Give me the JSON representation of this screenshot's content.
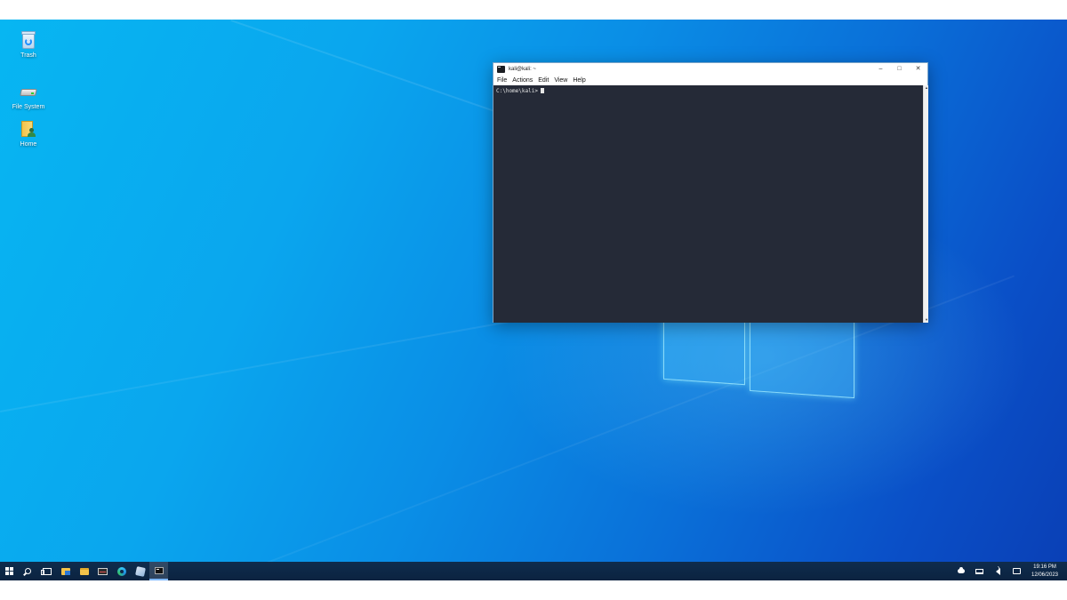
{
  "desktop": {
    "icons": [
      {
        "label": "Trash"
      },
      {
        "label": "File System"
      },
      {
        "label": "Home"
      }
    ]
  },
  "terminal": {
    "title": "kali@kali: ~",
    "menu": [
      "File",
      "Actions",
      "Edit",
      "View",
      "Help"
    ],
    "prompt": "C:\\home\\kali>",
    "buttons": {
      "minimize": "–",
      "maximize": "□",
      "close": "✕"
    },
    "scroll": {
      "up": "▲",
      "down": "▼"
    }
  },
  "taskbar": {
    "icons": [
      "windows-start-icon",
      "search-icon",
      "task-view-icon",
      "file-explorer-icon",
      "folder-icon",
      "task-manager-icon",
      "edge-browser-icon",
      "tools-icon",
      "terminal-icon"
    ],
    "active": "terminal-icon",
    "clock": {
      "time": "19:16 PM",
      "date": "12/06/2023"
    }
  },
  "colors": {
    "taskbar": "#0e2a4a",
    "terminal_bg": "#252a37",
    "accent": "#0a8ee6"
  }
}
